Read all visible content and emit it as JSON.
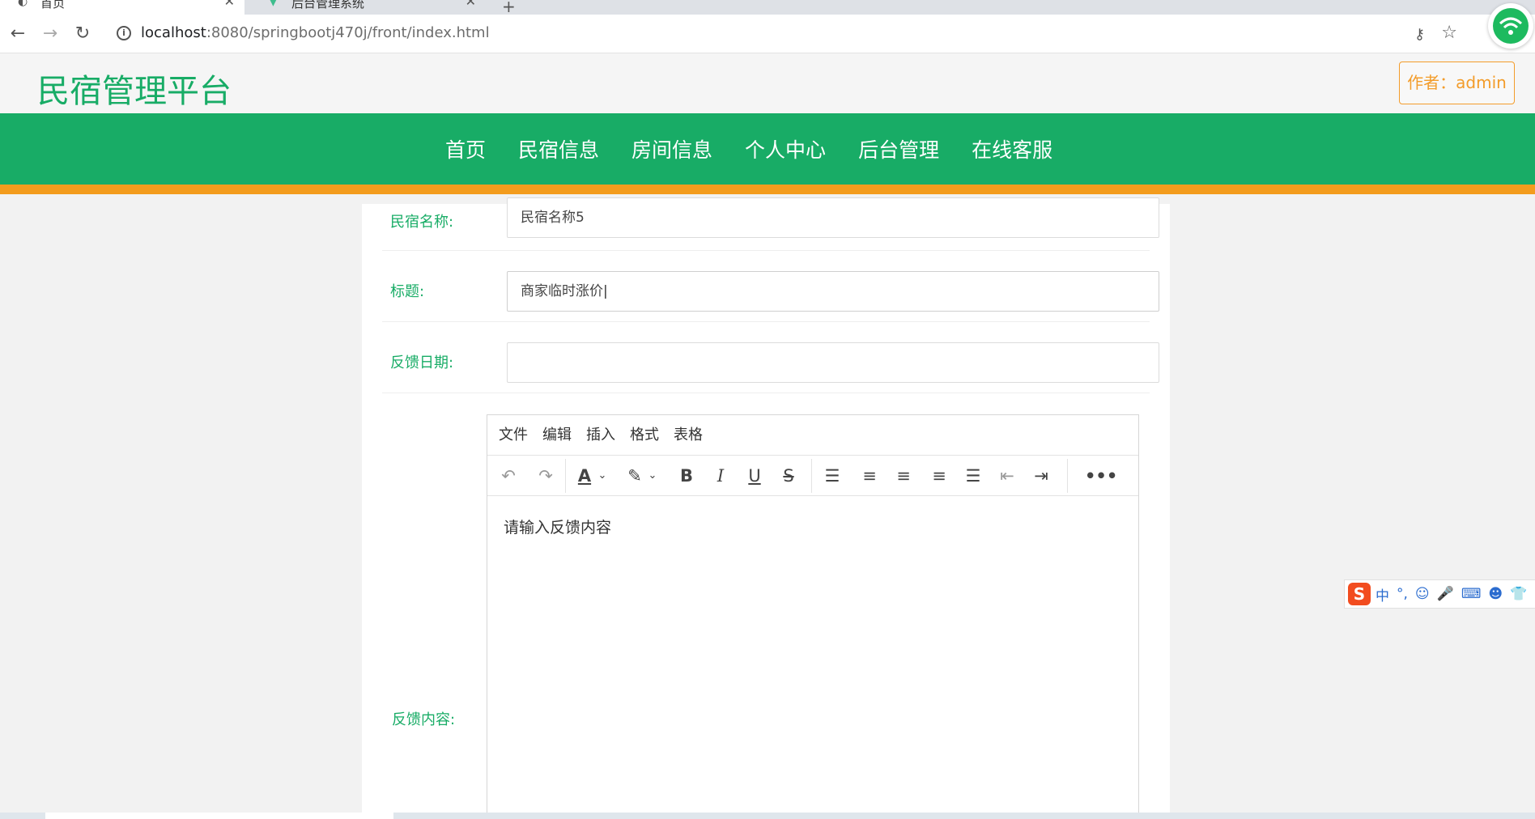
{
  "browser": {
    "tabs": [
      {
        "label": "首页",
        "active": true
      },
      {
        "label": "后台管理系统",
        "active": false
      }
    ],
    "new_tab_symbol": "+",
    "url_host": "localhost",
    "url_rest": ":8080/springbootj470j/front/index.html"
  },
  "header": {
    "site_title": "民宿管理平台",
    "author_label": "作者：admin"
  },
  "nav": {
    "items": [
      "首页",
      "民宿信息",
      "房间信息",
      "个人中心",
      "后台管理",
      "在线客服"
    ]
  },
  "form": {
    "homestay_name_label": "民宿名称:",
    "homestay_name_value": "民宿名称5",
    "title_label": "标题:",
    "title_value": "商家临时涨价",
    "date_label": "反馈日期:",
    "date_value": "",
    "content_label": "反馈内容:",
    "editor": {
      "menus": [
        "文件",
        "编辑",
        "插入",
        "格式",
        "表格"
      ],
      "placeholder": "请输入反馈内容"
    }
  },
  "ime": {
    "logo": "S",
    "mode": "中"
  },
  "colors": {
    "brand_green": "#18ac66",
    "accent_orange": "#f39c1d"
  }
}
